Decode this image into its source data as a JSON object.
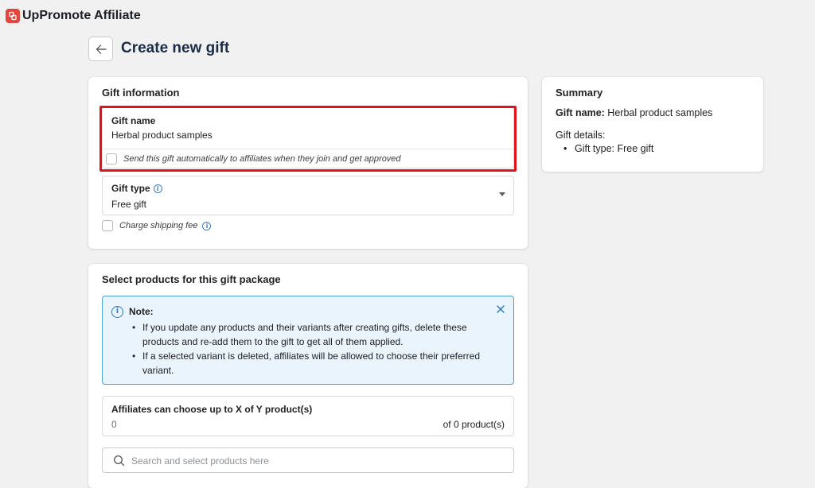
{
  "app": {
    "title": "UpPromote Affiliate",
    "logo_color": "#e3463d"
  },
  "page": {
    "title": "Create new gift"
  },
  "gift_information": {
    "title": "Gift information",
    "gift_name": {
      "label": "Gift name",
      "value": "Herbal product samples"
    },
    "auto_send": {
      "label": "Send this gift automatically to affiliates when they join and get approved",
      "checked": false
    },
    "gift_type": {
      "label": "Gift type",
      "value": "Free gift"
    },
    "charge_shipping": {
      "label": "Charge shipping fee",
      "checked": false
    },
    "highlight_color": "#e0131c"
  },
  "products": {
    "title": "Select products for this gift package",
    "note": {
      "title": "Note:",
      "items": [
        "If you update any products and their variants after creating gifts, delete these products and re-add them to the gift to get all of them applied.",
        "If a selected variant is deleted, affiliates will be allowed to choose their preferred variant."
      ],
      "accent_color": "#2e7bbf"
    },
    "choose": {
      "label": "Affiliates can choose up to X of Y product(s)",
      "value": "0",
      "of_label": "of 0 product(s)"
    },
    "search": {
      "placeholder": "Search and select products here"
    }
  },
  "summary": {
    "title": "Summary",
    "gift_name_label": "Gift name:",
    "gift_name_value": "Herbal product samples",
    "gift_details_label": "Gift details:",
    "details": [
      "Gift type: Free gift"
    ]
  },
  "icons": {
    "back": "arrow-left-icon",
    "info": "info-icon",
    "close": "close-icon",
    "search": "search-icon",
    "dropdown": "chevron-down-icon"
  }
}
